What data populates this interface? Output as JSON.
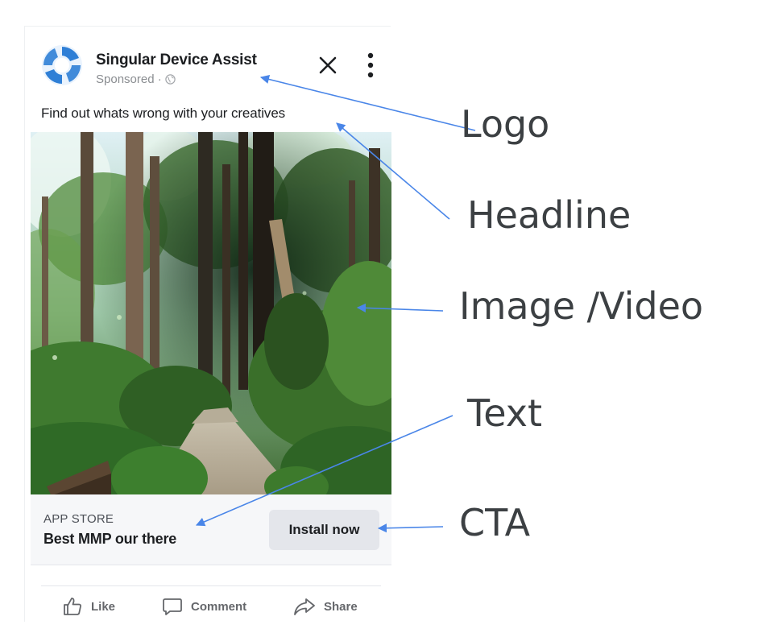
{
  "ad": {
    "advertiser_name": "Singular Device Assist",
    "sponsored_label": "Sponsored ·",
    "headline": "Find out whats wrong with your creatives",
    "store_label": "APP STORE",
    "ad_text": "Best MMP our there",
    "cta_label": "Install now",
    "actions": {
      "like": "Like",
      "comment": "Comment",
      "share": "Share"
    }
  },
  "annotations": {
    "logo": "Logo",
    "headline": "Headline",
    "image_video": "Image /Video",
    "text": "Text",
    "cta": "CTA"
  },
  "icons": {
    "logo": "aperture-logo-icon",
    "privacy": "globe-icon",
    "close": "close-icon",
    "more": "more-vertical-icon",
    "like": "thumbs-up-icon",
    "comment": "comment-bubble-icon",
    "share": "share-arrow-icon"
  },
  "colors": {
    "logo_blue": "#2f7fd6",
    "annotation_arrow": "#4a86e8",
    "cta_background": "#e4e6eb",
    "cta_bar_background": "#f6f7f9"
  }
}
